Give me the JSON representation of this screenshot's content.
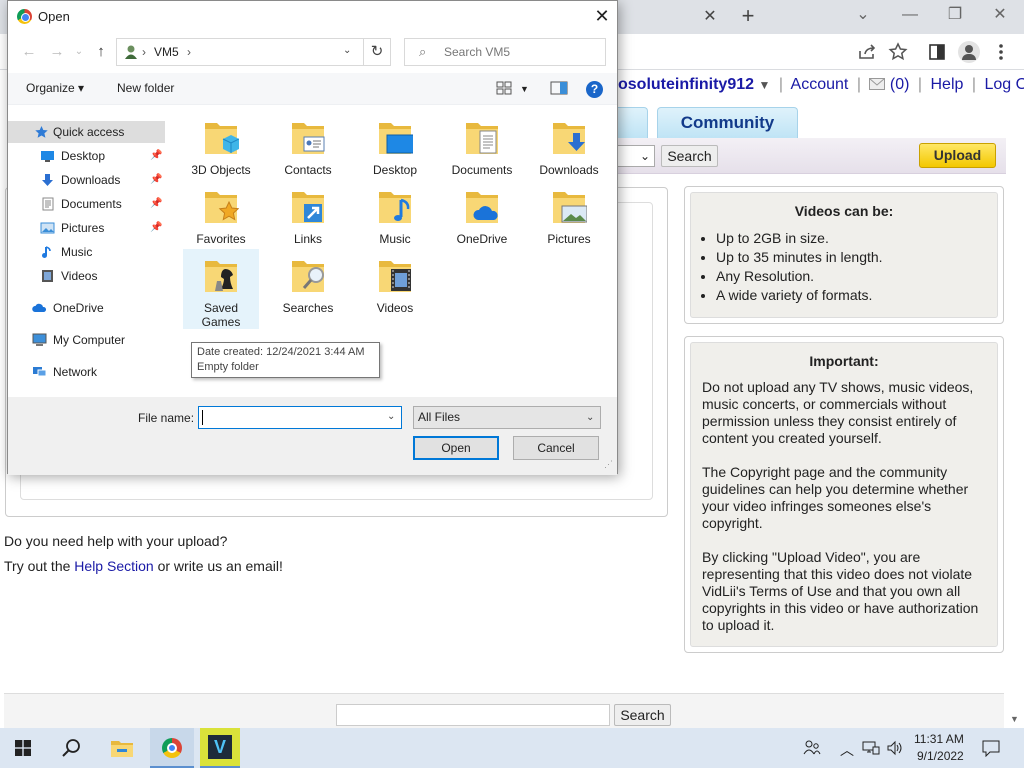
{
  "browser": {
    "tab_close": "✕",
    "new_tab": "+",
    "window_controls": [
      "⌄",
      "—",
      "❐",
      "✕"
    ],
    "toolbar_icons": [
      "share-icon",
      "star-icon",
      "side-panel-icon",
      "profile-icon",
      "menu-icon"
    ]
  },
  "site": {
    "username": "osoluteinfinity912",
    "username_caret": "▼",
    "account": "Account",
    "messages": "(0)",
    "help": "Help",
    "logout": "Log Out",
    "tab_community": "Community",
    "search_button": "Search",
    "upload_button": "Upload",
    "help_question": "Do you need help with your upload?",
    "help_line_prefix": "Try out the ",
    "help_link": "Help Section",
    "help_line_suffix": " or write us an email!",
    "videos_box": {
      "title": "Videos can be:",
      "items": [
        "Up to 2GB in size.",
        "Up to 35 minutes in length.",
        "Any Resolution.",
        "A wide variety of formats."
      ]
    },
    "important_box": {
      "title": "Important:",
      "paragraphs": [
        "Do not upload any TV shows, music videos, music concerts, or commercials without permission unless they consist entirely of content you created yourself.",
        "The Copyright page and the community guidelines can help you determine whether your video infringes someones else's copyright.",
        "By clicking \"Upload Video\", you are representing that this video does not violate VidLii's Terms of Use and that you own all copyrights in this video or have authorization to upload it."
      ]
    },
    "bottom_search_button": "Search"
  },
  "dialog": {
    "title": "Open",
    "close": "✕",
    "path": [
      "VM5"
    ],
    "search_placeholder": "Search VM5",
    "organize": "Organize ▾",
    "new_folder": "New folder",
    "help_glyph": "?",
    "nav": [
      {
        "label": "Quick access",
        "icon": "star-icon",
        "color": "#2f7bd6",
        "pinned": false,
        "selected": true
      },
      {
        "label": "Desktop",
        "icon": "desktop-icon",
        "color": "#1e88e5",
        "pinned": true
      },
      {
        "label": "Downloads",
        "icon": "download-icon",
        "color": "#2b6fd1",
        "pinned": true
      },
      {
        "label": "Documents",
        "icon": "documents-icon",
        "color": "#8a8a8a",
        "pinned": true
      },
      {
        "label": "Pictures",
        "icon": "pictures-icon",
        "color": "#3a8ed8",
        "pinned": true
      },
      {
        "label": "Music",
        "icon": "music-icon",
        "color": "#1f7ae0",
        "pinned": false
      },
      {
        "label": "Videos",
        "icon": "videos-icon",
        "color": "#555555",
        "pinned": false
      },
      {
        "label": "OneDrive",
        "icon": "cloud-icon",
        "color": "#1a73d9",
        "pinned": false
      },
      {
        "label": "My Computer",
        "icon": "computer-icon",
        "color": "#3d8fd9",
        "pinned": false
      },
      {
        "label": "Network",
        "icon": "network-icon",
        "color": "#2b7bd3",
        "pinned": false
      }
    ],
    "folders": [
      {
        "label": "3D Objects",
        "overlay": "cube",
        "selected": false
      },
      {
        "label": "Contacts",
        "overlay": "card",
        "selected": false
      },
      {
        "label": "Desktop",
        "overlay": "screen",
        "selected": false
      },
      {
        "label": "Documents",
        "overlay": "doc",
        "selected": false
      },
      {
        "label": "Downloads",
        "overlay": "arrow",
        "selected": false
      },
      {
        "label": "Favorites",
        "overlay": "star",
        "selected": false
      },
      {
        "label": "Links",
        "overlay": "link",
        "selected": false
      },
      {
        "label": "Music",
        "overlay": "note",
        "selected": false
      },
      {
        "label": "OneDrive",
        "overlay": "cloud",
        "selected": false
      },
      {
        "label": "Pictures",
        "overlay": "photo",
        "selected": false
      },
      {
        "label": "Saved Games",
        "overlay": "chess",
        "selected": true
      },
      {
        "label": "Searches",
        "overlay": "magnifier",
        "selected": false
      },
      {
        "label": "Videos",
        "overlay": "film",
        "selected": false
      }
    ],
    "tooltip": {
      "line1": "Date created: 12/24/2021 3:44 AM",
      "line2": "Empty folder"
    },
    "file_name_label": "File name:",
    "file_name_value": "",
    "file_type": "All Files",
    "open_button": "Open",
    "cancel_button": "Cancel"
  },
  "taskbar": {
    "clock_time": "11:31 AM",
    "clock_date": "9/1/2022",
    "apps": [
      "start-icon",
      "search-icon",
      "file-explorer-icon",
      "chrome-icon",
      "vidlii-app-icon"
    ],
    "vidlii_letter": "V"
  }
}
